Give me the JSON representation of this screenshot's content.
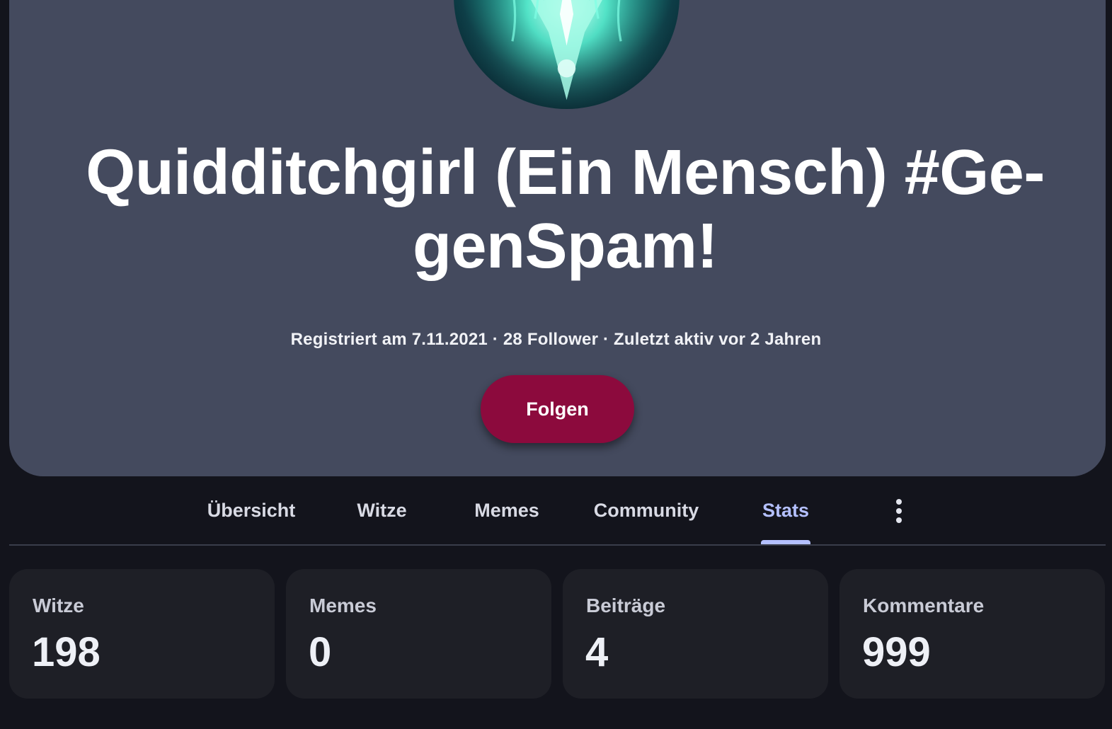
{
  "profile": {
    "name": "Quidditchgirl (Ein Mensch) #Ge-genSpam!",
    "meta": "Registriert am 7.11.2021 · 28 Follower · Zuletzt aktiv vor 2 Jahren",
    "follow_label": "Folgen",
    "avatar_icon": "wolf-avatar-image"
  },
  "tabs": {
    "items": [
      {
        "label": "Übersicht"
      },
      {
        "label": "Witze"
      },
      {
        "label": "Memes"
      },
      {
        "label": "Community"
      },
      {
        "label": "Stats"
      }
    ],
    "active_index": 4,
    "more_icon": "more-vertical-icon"
  },
  "stats": [
    {
      "label": "Witze",
      "value": "198"
    },
    {
      "label": "Memes",
      "value": "0"
    },
    {
      "label": "Beiträge",
      "value": "4"
    },
    {
      "label": "Kommentare",
      "value": "999"
    }
  ],
  "colors": {
    "background": "#13141c",
    "card": "#444a5e",
    "accent": "#8c0a3d",
    "active_tab": "#b4c0ff",
    "stat_card": "#1e1f26"
  }
}
